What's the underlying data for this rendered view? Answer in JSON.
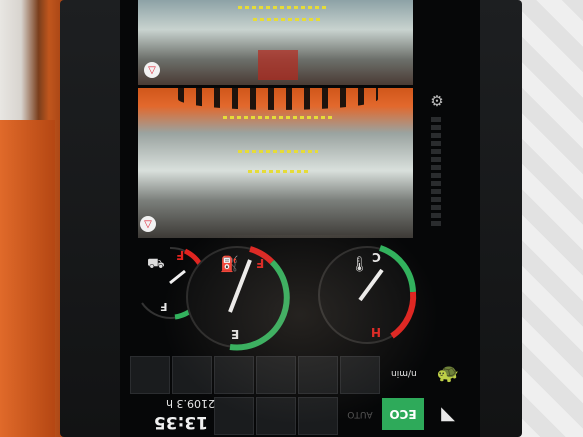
{
  "camera_views": {
    "top": {
      "icon": "camera-view-icon"
    },
    "bottom": {
      "icon": "camera-view-icon"
    }
  },
  "gauges": {
    "small": {
      "marker_full": "F",
      "marker_empty": "F",
      "icon": "adblue-icon"
    },
    "fuel": {
      "marker_full": "F",
      "marker_empty": "E",
      "icon": "fuel-pump-icon"
    },
    "temperature": {
      "marker_cold": "C",
      "marker_hot": "H",
      "icon": "coolant-temperature-icon"
    }
  },
  "status": {
    "engine_hours": "2109.3 h",
    "clock": "13:35"
  },
  "buttons": {
    "eco": "ECO",
    "auto": "AUTO",
    "auto_rpm": "n/min"
  },
  "colors": {
    "accent_green": "#2eaa5a",
    "gauge_red": "#e0231f",
    "gauge_green": "#2fb25c",
    "cam_orange": "#e2682c"
  }
}
